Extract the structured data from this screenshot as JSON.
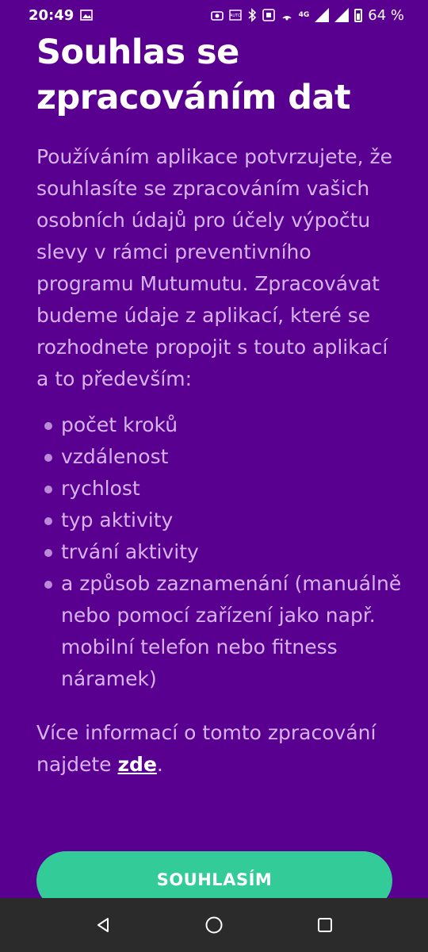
{
  "status_bar": {
    "time": "20:49",
    "network": "4G",
    "battery": "64 %",
    "icons": [
      "image-icon",
      "camera-icon",
      "auto-icon",
      "bluetooth-icon",
      "nfc-icon",
      "hotspot-icon",
      "signal-icon",
      "battery-icon"
    ]
  },
  "consent": {
    "title": "Souhlas se zpracováním dat",
    "intro": "Používáním aplikace potvrzujete, že souhlasíte se zpracováním vašich osobních údajů pro účely výpočtu slevy v rámci preventivního programu Mutumutu. Zpracovávat budeme údaje z aplikací, které se rozhodnete propojit s touto aplikací a to především:",
    "items": [
      "počet kroků",
      "vzdálenost",
      "rychlost",
      "typ aktivity",
      "trvání aktivity",
      "a způsob zaznamenání (manuálně nebo pomocí zařízení jako např. mobilní telefon nebo fitness náramek)"
    ],
    "more_info_prefix": "Více informací o tomto zpracování najdete ",
    "more_info_link": "zde",
    "more_info_suffix": "."
  },
  "buttons": {
    "agree_label": "SOUHLASÍM"
  },
  "colors": {
    "background": "#5a0090",
    "accent": "#33cc99",
    "text_muted": "#d7b3ee",
    "nav_bar": "#2b2b2b"
  }
}
